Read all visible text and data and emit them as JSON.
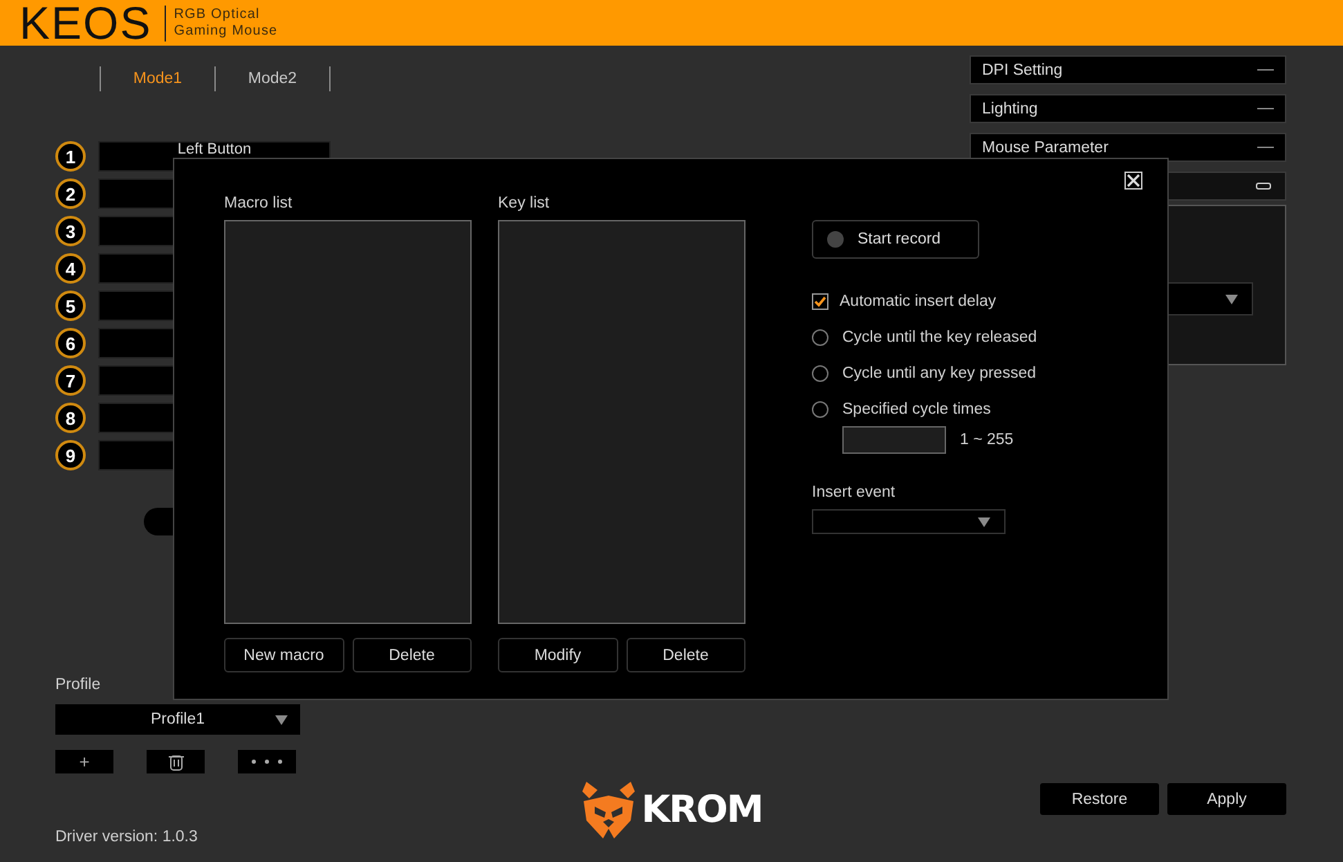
{
  "header": {
    "logo": "KEOS",
    "subtitle_lines": [
      "RGB Optical",
      "Gaming Mouse"
    ]
  },
  "mode_tabs": [
    {
      "label": "Mode1",
      "selected": true
    },
    {
      "label": "Mode2",
      "selected": false
    }
  ],
  "button_slots": [
    {
      "number": "1",
      "label": "Left Button"
    },
    {
      "number": "2"
    },
    {
      "number": "3"
    },
    {
      "number": "4"
    },
    {
      "number": "5"
    },
    {
      "number": "6"
    },
    {
      "number": "7"
    },
    {
      "number": "8"
    },
    {
      "number": "9"
    }
  ],
  "side_panels": [
    {
      "title": "DPI Setting"
    },
    {
      "title": "Lighting"
    },
    {
      "title": "Mouse Parameter"
    }
  ],
  "profile": {
    "label": "Profile",
    "value": "Profile1",
    "add_button": "+"
  },
  "brand": "KROM",
  "footer_buttons": [
    "Restore",
    "Apply"
  ],
  "driver_version": "Driver version: 1.0.3",
  "dialog": {
    "lists": [
      {
        "label": "Macro list",
        "buttons": [
          "New macro",
          "Delete"
        ]
      },
      {
        "label": "Key list",
        "buttons": [
          "Modify",
          "Delete"
        ]
      }
    ],
    "start_record": "Start record",
    "options": [
      {
        "kind": "checkbox",
        "label": "Automatic insert delay",
        "checked": true
      },
      {
        "kind": "radio",
        "label": "Cycle until the key released",
        "selected": false
      },
      {
        "kind": "radio",
        "label": "Cycle until any key pressed",
        "selected": false
      },
      {
        "kind": "radio",
        "label": "Specified cycle times",
        "selected": false
      }
    ],
    "cycle_range": "1 ~ 255",
    "insert_event": {
      "label": "Insert event"
    }
  }
}
